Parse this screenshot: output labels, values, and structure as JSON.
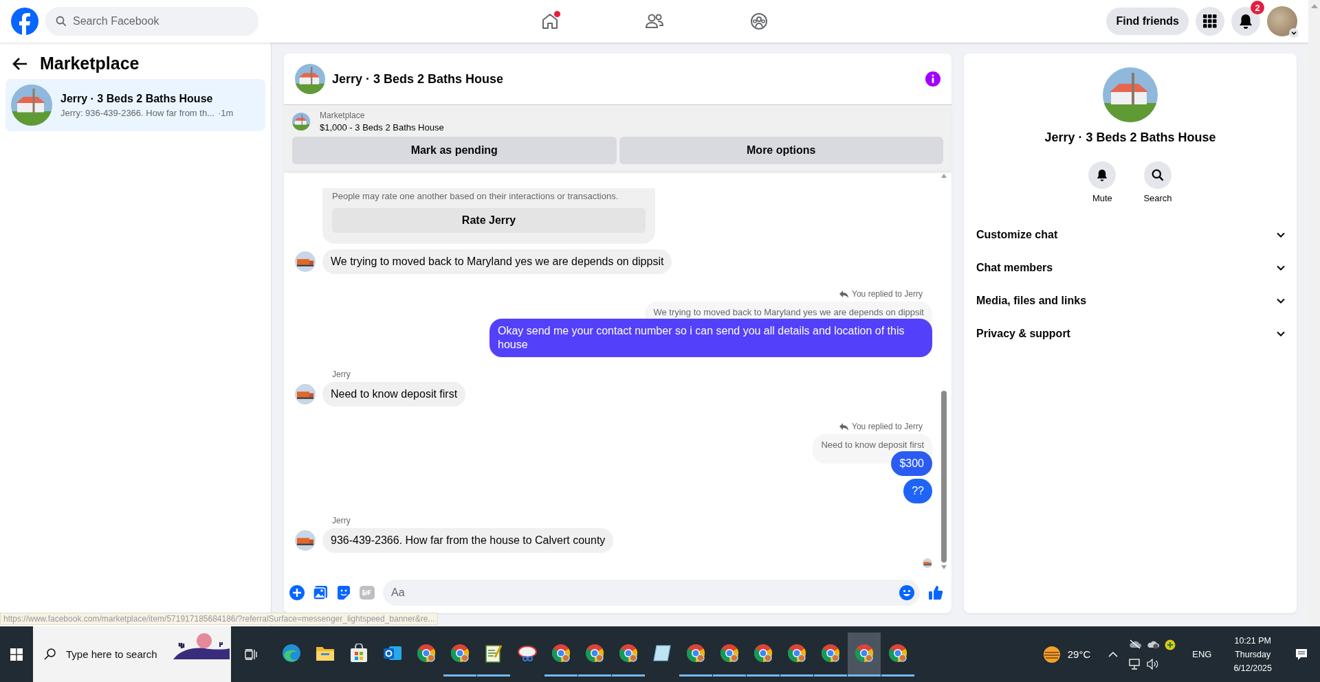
{
  "top_bar": {
    "search": {
      "placeholder": "Search Facebook"
    },
    "nav": [
      {
        "kind": "home",
        "has_notification": true
      },
      {
        "kind": "friends",
        "has_notification": false
      },
      {
        "kind": "groups",
        "has_notification": false
      }
    ],
    "find_friends": "Find friends",
    "notification_count": "2"
  },
  "sidebar": {
    "title": "Marketplace",
    "conversations": [
      {
        "title": "Jerry · 3 Beds 2 Baths House",
        "preview": "Jerry: 936-439-2366. How far from th...",
        "time": "·1m",
        "selected": true
      }
    ]
  },
  "chat": {
    "title": "Jerry · 3 Beds 2 Baths House",
    "listing": {
      "source": "Marketplace",
      "title": "$1,000 - 3 Beds 2 Baths House"
    },
    "actions": [
      "Mark as pending",
      "More options"
    ],
    "messages": [
      {
        "kind": "rating",
        "text": "People may rate one another based on their interactions or transactions.",
        "button": "Rate Jerry"
      },
      {
        "kind": "incoming",
        "text": "We trying to moved back to Maryland yes we are depends on dippsit"
      },
      {
        "kind": "outgoing",
        "reply_label": "You replied to Jerry",
        "quote": "We trying to moved back to Maryland yes we are depends on dippsit",
        "bubbles": [
          {
            "text": "Okay send me your contact number so i can send you all details and location of this house",
            "color": "#5340fa"
          }
        ]
      },
      {
        "kind": "incoming",
        "sender": "Jerry",
        "text": "Need to know deposit first"
      },
      {
        "kind": "outgoing",
        "reply_label": "You replied to Jerry",
        "quote": "Need to know deposit first",
        "bubbles": [
          {
            "text": "$300",
            "color": "#2a5cf3"
          },
          {
            "text": "??",
            "color": "#1e64f7"
          }
        ]
      },
      {
        "kind": "incoming",
        "sender": "Jerry",
        "text": "936-439-2366. How far from the house to Calvert county"
      }
    ],
    "seen": true,
    "composer": {
      "placeholder": "Aa"
    }
  },
  "details": {
    "title": "Jerry · 3 Beds 2 Baths House",
    "actions": [
      {
        "kind": "mute",
        "label": "Mute"
      },
      {
        "kind": "search",
        "label": "Search"
      }
    ],
    "sections": [
      {
        "label": "Customize chat",
        "expanded": false
      },
      {
        "label": "Chat members",
        "expanded": false
      },
      {
        "label": "Media, files and links",
        "expanded": false
      },
      {
        "label": "Privacy & support",
        "expanded": false
      }
    ]
  },
  "status_url": "https://www.facebook.com/marketplace/item/571917185684186/?referralSurface=messenger_lightspeed_banner&re...",
  "taskbar": {
    "search": {
      "placeholder": "Type here to search"
    },
    "apps": [
      {
        "kind": "edge",
        "open": false,
        "selected": false
      },
      {
        "kind": "folder",
        "open": false,
        "selected": false
      },
      {
        "kind": "store",
        "open": false,
        "selected": false
      },
      {
        "kind": "outlook",
        "open": false,
        "selected": false
      },
      {
        "kind": "chrome",
        "open": false,
        "selected": false
      },
      {
        "kind": "chrome",
        "open": true,
        "selected": false
      },
      {
        "kind": "notes",
        "open": true,
        "selected": false
      },
      {
        "kind": "snip",
        "open": false,
        "selected": false
      },
      {
        "kind": "chrome",
        "open": true,
        "selected": false
      },
      {
        "kind": "chrome",
        "open": true,
        "selected": false
      },
      {
        "kind": "chrome",
        "open": true,
        "selected": false
      },
      {
        "kind": "pad",
        "open": false,
        "selected": false
      },
      {
        "kind": "chrome",
        "open": true,
        "selected": false
      },
      {
        "kind": "chrome",
        "open": true,
        "selected": false
      },
      {
        "kind": "chrome",
        "open": true,
        "selected": false
      },
      {
        "kind": "chrome",
        "open": true,
        "selected": false
      },
      {
        "kind": "chrome",
        "open": true,
        "selected": false
      },
      {
        "kind": "chrome",
        "open": true,
        "selected": true
      },
      {
        "kind": "chrome",
        "open": true,
        "selected": false
      }
    ],
    "weather": "29°C",
    "language": "ENG",
    "time": "10:21 PM",
    "day": "Thursday",
    "date": "6/12/2025"
  }
}
